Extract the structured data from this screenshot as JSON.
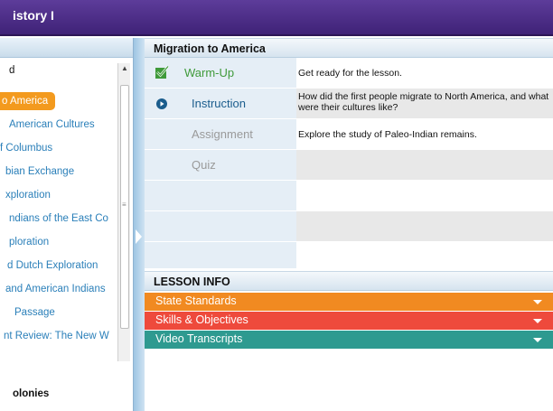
{
  "window": {
    "title": "istory I"
  },
  "sidebar": {
    "items": [
      {
        "label": "d",
        "style": "dark"
      },
      {
        "label": "o America",
        "style": "active"
      },
      {
        "label": "American Cultures",
        "style": "link"
      },
      {
        "label": "f Columbus",
        "style": "link"
      },
      {
        "label": "bian Exchange",
        "style": "link"
      },
      {
        "label": "xploration",
        "style": "link"
      },
      {
        "label": "ndians of the East Co",
        "style": "link"
      },
      {
        "label": "ploration",
        "style": "link"
      },
      {
        "label": "d Dutch Exploration",
        "style": "link"
      },
      {
        "label": "and American Indians",
        "style": "link"
      },
      {
        "label": "Passage",
        "style": "link"
      },
      {
        "label": "nt Review: The New W",
        "style": "link"
      },
      {
        "label": "olonies",
        "style": "bold"
      }
    ]
  },
  "lesson": {
    "title": "Migration to America",
    "rows": [
      {
        "name": "Warm-Up",
        "status": "complete",
        "description": "Get ready for the lesson."
      },
      {
        "name": "Instruction",
        "status": "current",
        "description": "How did the first people migrate to North America, and what were their cultures like?"
      },
      {
        "name": "Assignment",
        "status": "locked",
        "description": "Explore the study of Paleo-Indian remains."
      },
      {
        "name": "Quiz",
        "status": "locked",
        "description": ""
      }
    ]
  },
  "lesson_info": {
    "title": "LESSON INFO",
    "bars": [
      {
        "label": "State Standards",
        "color": "#f18a21"
      },
      {
        "label": "Skills & Objectives",
        "color": "#ee4a3c"
      },
      {
        "label": "Video Transcripts",
        "color": "#2e9a90"
      }
    ]
  },
  "colors": {
    "titlebar": "#4b2c86",
    "active_item": "#f39a1e",
    "link": "#2a7fb9",
    "complete": "#3f9a3a",
    "current": "#1b5d8d"
  }
}
